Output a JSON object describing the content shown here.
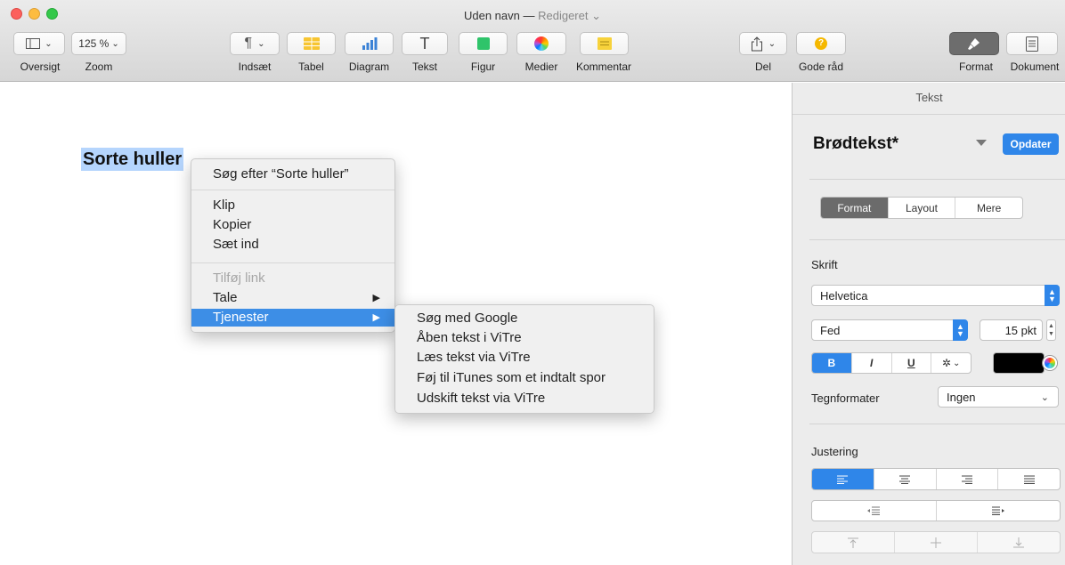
{
  "window": {
    "title": "Uden navn",
    "separator": "—",
    "status": "Redigeret",
    "status_chevron": "⌄"
  },
  "toolbar": {
    "oversigt": "Oversigt",
    "zoom_value": "125 %",
    "zoom": "Zoom",
    "indsaet": "Indsæt",
    "tabel": "Tabel",
    "diagram": "Diagram",
    "tekst": "Tekst",
    "figur": "Figur",
    "medier": "Medier",
    "kommentar": "Kommentar",
    "del": "Del",
    "gode_raad": "Gode råd",
    "format": "Format",
    "dokument": "Dokument"
  },
  "document": {
    "heading": "Sorte huller"
  },
  "context_menu": {
    "search": "Søg efter “Sorte huller”",
    "klip": "Klip",
    "kopier": "Kopier",
    "saet_ind": "Sæt ind",
    "tilfoej_link": "Tilføj link",
    "tale": "Tale",
    "tjenester": "Tjenester"
  },
  "services_menu": [
    "Søg med Google",
    "Åben tekst i ViTre",
    "Læs tekst via ViTre",
    "Føj til iTunes som et indtalt spor",
    "Udskift tekst via ViTre"
  ],
  "inspector": {
    "header": "Tekst",
    "style_name": "Brødtekst*",
    "update": "Opdater",
    "tabs": [
      "Format",
      "Layout",
      "Mere"
    ],
    "skrift_label": "Skrift",
    "font_family": "Helvetica",
    "font_weight": "Fed",
    "font_size": "15 pkt",
    "style_buttons": [
      "B",
      "I",
      "U"
    ],
    "gear": "✲",
    "tegnformater_label": "Tegnformater",
    "tegnformater_value": "Ingen",
    "justering_label": "Justering"
  },
  "colors": {
    "accent": "#2f86e9",
    "selection": "#b5d5fd",
    "menu_highlight": "#3d8ee6"
  }
}
